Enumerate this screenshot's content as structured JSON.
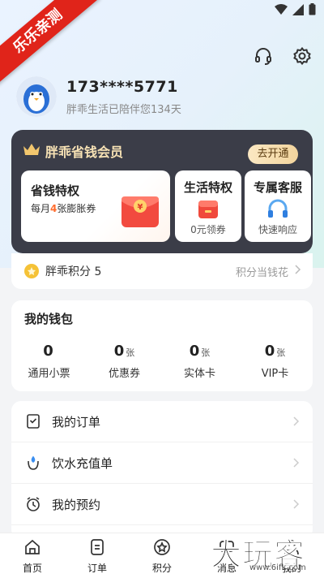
{
  "watermark": {
    "ribbon": "乐乐亲测",
    "corner": "大玩客",
    "url": "www.6ifk.com"
  },
  "profile": {
    "phone": "173****5771",
    "subtitle": "胖乖生活已陪伴您134天"
  },
  "vip": {
    "title": "胖乖省钱会员",
    "open_button": "去开通",
    "perks": [
      {
        "title": "省钱特权",
        "sub_prefix": "每月",
        "sub_num": "4",
        "sub_suffix": "张膨胀券"
      },
      {
        "title": "生活特权",
        "sub": "0元领券"
      },
      {
        "title": "专属客服",
        "sub": "快速响应"
      }
    ]
  },
  "points": {
    "label": "胖乖积分 5",
    "right": "积分当钱花"
  },
  "wallet": {
    "title": "我的钱包",
    "items": [
      {
        "value": "0",
        "unit": "",
        "label": "通用小票"
      },
      {
        "value": "0",
        "unit": "张",
        "label": "优惠券"
      },
      {
        "value": "0",
        "unit": "张",
        "label": "实体卡"
      },
      {
        "value": "0",
        "unit": "张",
        "label": "VIP卡"
      }
    ]
  },
  "menu": [
    {
      "label": "我的订单",
      "icon": "order-icon"
    },
    {
      "label": "饮水充值单",
      "icon": "water-icon"
    },
    {
      "label": "我的预约",
      "icon": "clock-icon"
    }
  ],
  "tabbar": [
    {
      "label": "首页",
      "icon": "home-icon"
    },
    {
      "label": "订单",
      "icon": "order-icon"
    },
    {
      "label": "积分",
      "icon": "star-icon"
    },
    {
      "label": "消息",
      "icon": "message-icon"
    },
    {
      "label": "我的",
      "icon": "user-icon"
    }
  ],
  "colors": {
    "accent_orange": "#ff6b2c",
    "vip_bg": "#3b3d48",
    "vip_gold": "#f7e2b5"
  }
}
